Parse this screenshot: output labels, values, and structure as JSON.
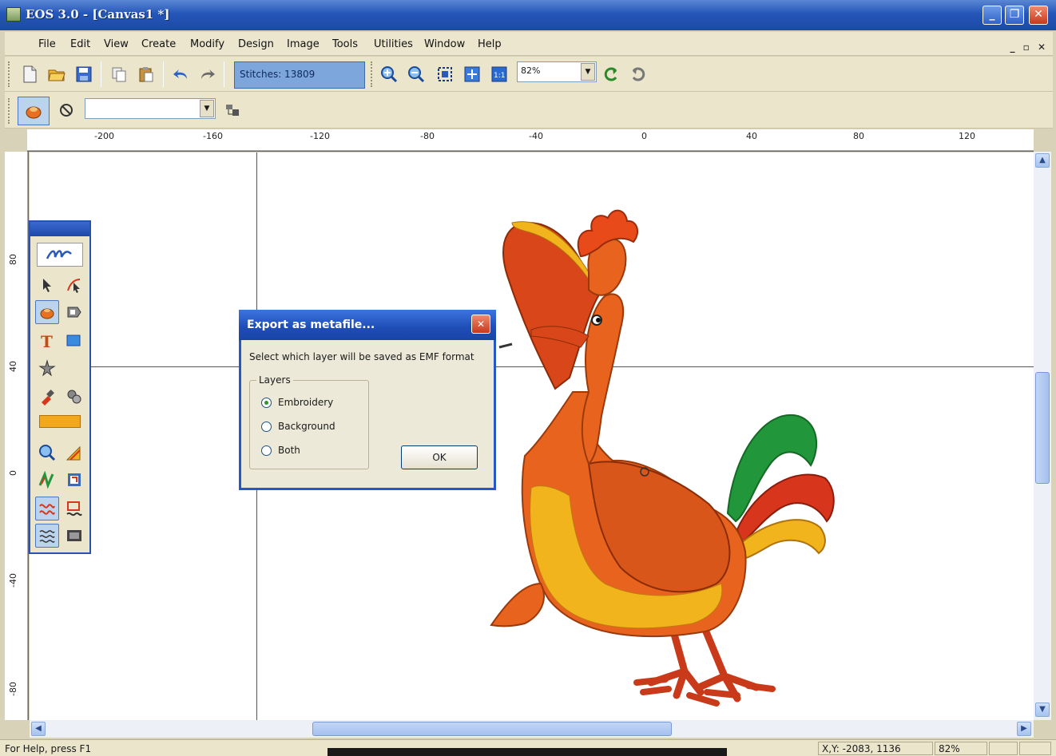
{
  "window": {
    "title": "EOS 3.0 - [Canvas1 *]",
    "min": "_",
    "max": "❐",
    "close": "✕"
  },
  "menu": {
    "items": [
      "File",
      "Edit",
      "View",
      "Create",
      "Modify",
      "Design",
      "Image",
      "Tools",
      "Utilities",
      "Window",
      "Help"
    ],
    "mdi_controls": "_ ▫ ✕"
  },
  "toolbar": {
    "stitches": "Stitches: 13809",
    "zoom": "82%"
  },
  "ruler": {
    "h_labels": [
      "-200",
      "-160",
      "-120",
      "-80",
      "-40",
      "0",
      "40",
      "80",
      "120"
    ],
    "v_labels": [
      "80",
      "40",
      "0",
      "-40",
      "-80"
    ]
  },
  "dialog": {
    "title": "Export as metafile...",
    "message": "Select which layer will be saved as EMF format",
    "group_label": "Layers",
    "options": [
      "Embroidery",
      "Background",
      "Both"
    ],
    "selected": "Embroidery",
    "ok_label": "OK"
  },
  "status": {
    "help": "For Help, press F1",
    "xy": "X,Y:  -2083, 1136",
    "zoom": "82%"
  },
  "colors": {
    "orange": "#e8641e",
    "yellow": "#f2b41c",
    "green": "#22963a",
    "red": "#d8361c",
    "title_blue": "#2456b8"
  }
}
